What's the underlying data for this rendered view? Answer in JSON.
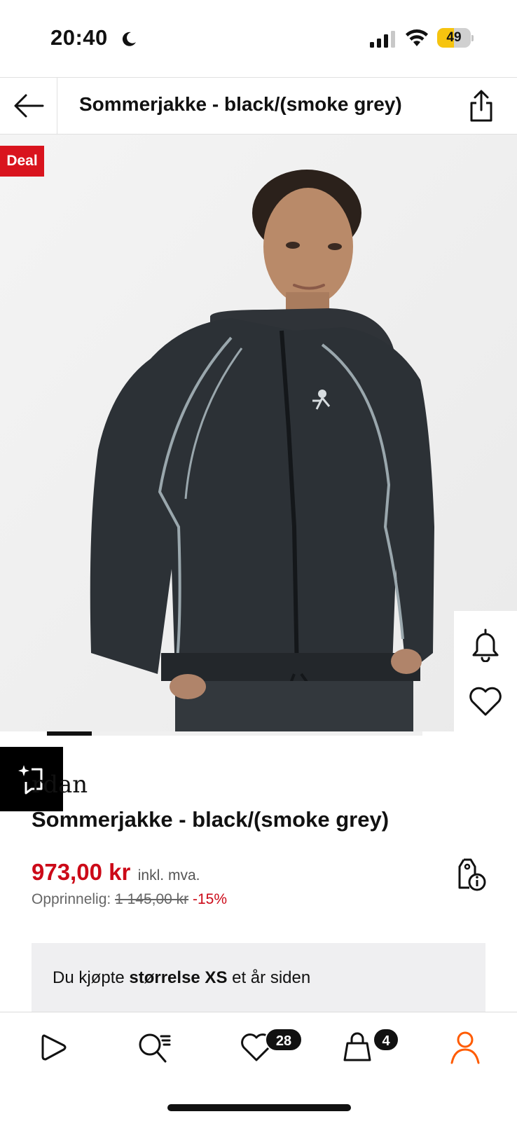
{
  "status_bar": {
    "time": "20:40",
    "battery": "49",
    "battery_level": 0.49,
    "icons": [
      "moon-icon",
      "signal-icon",
      "wifi-icon",
      "battery-icon"
    ]
  },
  "header": {
    "title": "Sommerjakke - black/(smoke grey)",
    "back_icon": "arrow-left-icon",
    "share_icon": "share-icon"
  },
  "product": {
    "badge": "Deal",
    "brand": "Jordan",
    "brand_visible": "rdan",
    "name": "Sommerjakke - black/(smoke grey)",
    "price": "973,00 kr",
    "vat_note": "inkl. mva.",
    "original_label": "Opprinnelig:",
    "original_price": "1 145,00 kr",
    "discount": "-15%",
    "carousel_progress": 0.12
  },
  "purchase_note": {
    "prefix": "Du kjøpte ",
    "size": "størrelse XS",
    "suffix": " et år siden"
  },
  "bottom_nav": {
    "items": [
      {
        "name": "play-icon"
      },
      {
        "name": "search-icon"
      },
      {
        "name": "heart-icon",
        "badge": "28"
      },
      {
        "name": "bag-icon",
        "badge": "4"
      },
      {
        "name": "profile-icon"
      }
    ]
  },
  "colors": {
    "accent": "#ff5b00",
    "price_red": "#cc0a18",
    "deal_red": "#d9141e"
  }
}
